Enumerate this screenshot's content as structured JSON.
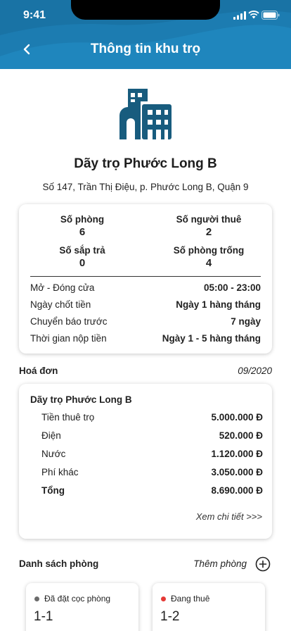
{
  "status_bar": {
    "time": "9:41"
  },
  "header": {
    "title": "Thông tin khu trọ",
    "accent": "#1f86bd"
  },
  "property": {
    "name": "Dãy trọ Phước Long B",
    "address": "Số 147, Trần Thị Điệu, p. Phước Long B, Quận 9",
    "icon": "building-icon",
    "icon_color": "#185c7e"
  },
  "stats": {
    "rooms_label": "Số phòng",
    "rooms_value": "6",
    "tenants_label": "Số người thuê",
    "tenants_value": "2",
    "leaving_label": "Số sắp trả",
    "leaving_value": "0",
    "vacant_label": "Số phòng trống",
    "vacant_value": "4"
  },
  "details": [
    {
      "label": "Mở - Đóng cửa",
      "value": "05:00 - 23:00"
    },
    {
      "label": "Ngày chốt tiền",
      "value": "Ngày 1 hàng tháng"
    },
    {
      "label": "Chuyển báo trước",
      "value": "7 ngày"
    },
    {
      "label": "Thời gian nộp tiền",
      "value": "Ngày 1 - 5 hàng tháng"
    }
  ],
  "invoice": {
    "section_label": "Hoá đơn",
    "period": "09/2020",
    "title": "Dãy trọ Phước Long B",
    "items": [
      {
        "label": "Tiền thuê trọ",
        "amount": "5.000.000 Đ"
      },
      {
        "label": "Điện",
        "amount": "520.000 Đ"
      },
      {
        "label": "Nước",
        "amount": "1.120.000 Đ"
      },
      {
        "label": "Phí khác",
        "amount": "3.050.000 Đ"
      },
      {
        "label": "Tổng",
        "amount": "8.690.000 Đ"
      }
    ],
    "view_detail": "Xem chi tiết >>>"
  },
  "rooms": {
    "section_label": "Danh sách phòng",
    "add_label": "Thêm phòng",
    "list": [
      {
        "status": "Đã đặt cọc phòng",
        "status_color": "#6b6b6b",
        "number": "1-1"
      },
      {
        "status": "Đang thuê",
        "status_color": "#e53935",
        "number": "1-2"
      }
    ]
  }
}
